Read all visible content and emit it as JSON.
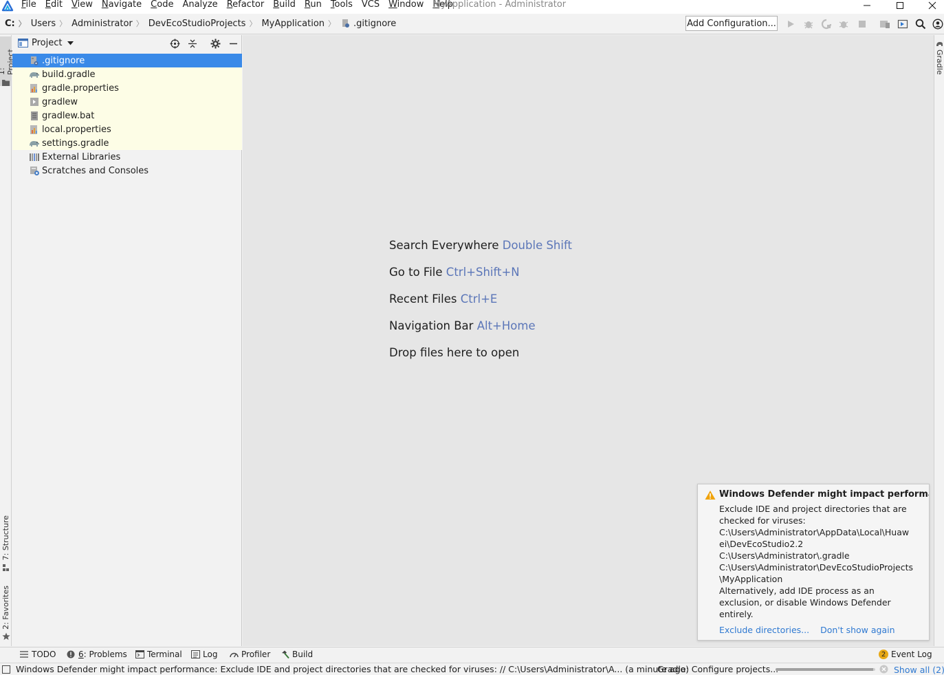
{
  "window": {
    "title": "MyApplication - Administrator",
    "menu": [
      {
        "label": "File",
        "mnemonic": "F",
        "rest": "ile"
      },
      {
        "label": "Edit",
        "mnemonic": "E",
        "rest": "dit"
      },
      {
        "label": "View",
        "mnemonic": "V",
        "rest": "iew"
      },
      {
        "label": "Navigate",
        "mnemonic": "N",
        "rest": "avigate"
      },
      {
        "label": "Code",
        "mnemonic": "C",
        "rest": "ode"
      },
      {
        "label": "Analyze",
        "mnemonic": "",
        "rest": "Analyze"
      },
      {
        "label": "Refactor",
        "mnemonic": "R",
        "rest": "efactor"
      },
      {
        "label": "Build",
        "mnemonic": "B",
        "rest": "uild"
      },
      {
        "label": "Run",
        "mnemonic": "R",
        "rest": "un"
      },
      {
        "label": "Tools",
        "mnemonic": "T",
        "rest": "ools"
      },
      {
        "label": "VCS",
        "mnemonic": "",
        "rest": "VCS"
      },
      {
        "label": "Window",
        "mnemonic": "W",
        "rest": "indow"
      },
      {
        "label": "Help",
        "mnemonic": "H",
        "rest": "elp"
      }
    ]
  },
  "breadcrumb": [
    "C:",
    "Users",
    "Administrator",
    "DevEcoStudioProjects",
    "MyApplication",
    ".gitignore"
  ],
  "toolbar": {
    "add_configuration": "Add Configuration..."
  },
  "left_tabs": {
    "project": "1: Project",
    "structure": "7: Structure",
    "favorites": "2: Favorites"
  },
  "right_tabs": {
    "gradle": "Gradle"
  },
  "project_panel": {
    "title": "Project",
    "items": [
      {
        "label": ".gitignore",
        "icon": "gitignore-file-icon",
        "state": "selected"
      },
      {
        "label": "build.gradle",
        "icon": "gradle-elephant-icon",
        "state": "yellow"
      },
      {
        "label": "gradle.properties",
        "icon": "properties-file-icon",
        "state": "yellow"
      },
      {
        "label": "gradlew",
        "icon": "script-file-icon",
        "state": "yellow"
      },
      {
        "label": "gradlew.bat",
        "icon": "bat-file-icon",
        "state": "yellow"
      },
      {
        "label": "local.properties",
        "icon": "properties-file-icon",
        "state": "yellow"
      },
      {
        "label": "settings.gradle",
        "icon": "gradle-elephant-icon",
        "state": "yellow"
      },
      {
        "label": "External Libraries",
        "icon": "libraries-icon",
        "state": "normal"
      },
      {
        "label": "Scratches and Consoles",
        "icon": "scratches-icon",
        "state": "normal"
      }
    ]
  },
  "editor_hints": [
    {
      "text": "Search Everywhere",
      "shortcut": "Double Shift"
    },
    {
      "text": "Go to File",
      "shortcut": "Ctrl+Shift+N"
    },
    {
      "text": "Recent Files",
      "shortcut": "Ctrl+E"
    },
    {
      "text": "Navigation Bar",
      "shortcut": "Alt+Home"
    },
    {
      "text": "Drop files here to open",
      "shortcut": ""
    }
  ],
  "notification": {
    "title": "Windows Defender might impact performance",
    "lines": [
      "Exclude IDE and project directories that are",
      "checked for viruses:",
      "C:\\Users\\Administrator\\AppData\\Local\\Huaw",
      "ei\\DevEcoStudio2.2",
      "C:\\Users\\Administrator\\.gradle",
      "C:\\Users\\Administrator\\DevEcoStudioProjects",
      "\\MyApplication",
      "Alternatively, add IDE process as an",
      "exclusion, or disable Windows Defender",
      "entirely."
    ],
    "link_exclude": "Exclude directories...",
    "link_dont_show": "Don't show again"
  },
  "bottom_tools": {
    "todo": "TODO",
    "problems_num": "6",
    "problems": ": Problems",
    "terminal": "Terminal",
    "log": "Log",
    "profiler": "Profiler",
    "build": "Build",
    "event_log_count": "2",
    "event_log": "Event Log"
  },
  "status": {
    "message": "Windows Defender might impact performance: Exclude IDE and project directories that are checked for viruses: // C:\\Users\\Administrator\\A... (a minute ago)",
    "gradle": "Gradle: Configure projects...",
    "progress_fraction": 0.98,
    "show_all": "Show all (2)"
  },
  "colors": {
    "selection": "#3a8ae8",
    "shortcut": "#5b76b8",
    "link": "#2f79d1",
    "modified_bg": "#fdfde6"
  }
}
